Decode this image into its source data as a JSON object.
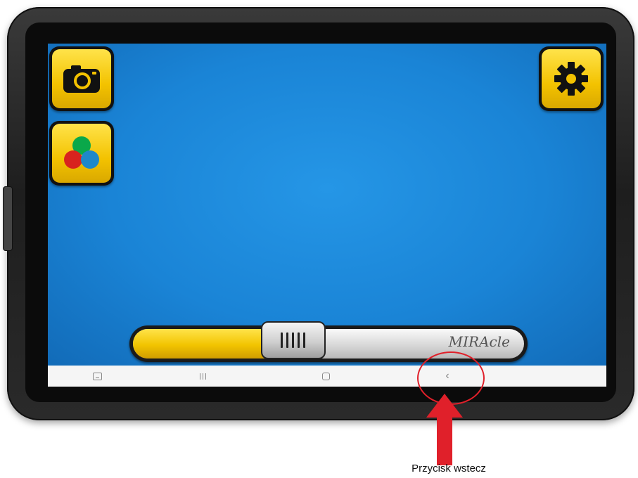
{
  "device": "tablet",
  "screen": {
    "background_color": "#1a84d6",
    "buttons": [
      {
        "name": "camera-button",
        "icon": "camera-icon",
        "color": "#f3c200"
      },
      {
        "name": "color-mode-button",
        "icon": "color-circles-icon",
        "color": "#f3c200"
      },
      {
        "name": "settings-button",
        "icon": "gear-icon",
        "color": "#f3c200"
      }
    ],
    "slider": {
      "brand_label": "MIRAcle",
      "fill_color": "#f2c400",
      "value_fraction": 0.41
    }
  },
  "navbar": {
    "keys": [
      {
        "name": "keyboard-key",
        "icon": "keyboard-icon"
      },
      {
        "name": "recent-apps-key",
        "icon": "recent-apps-icon"
      },
      {
        "name": "home-key",
        "icon": "home-icon"
      },
      {
        "name": "back-key",
        "icon": "back-chevron-icon",
        "glyph": "‹"
      }
    ]
  },
  "annotation": {
    "caption": "Przycisk wstecz",
    "highlight_color": "#e0202a"
  }
}
